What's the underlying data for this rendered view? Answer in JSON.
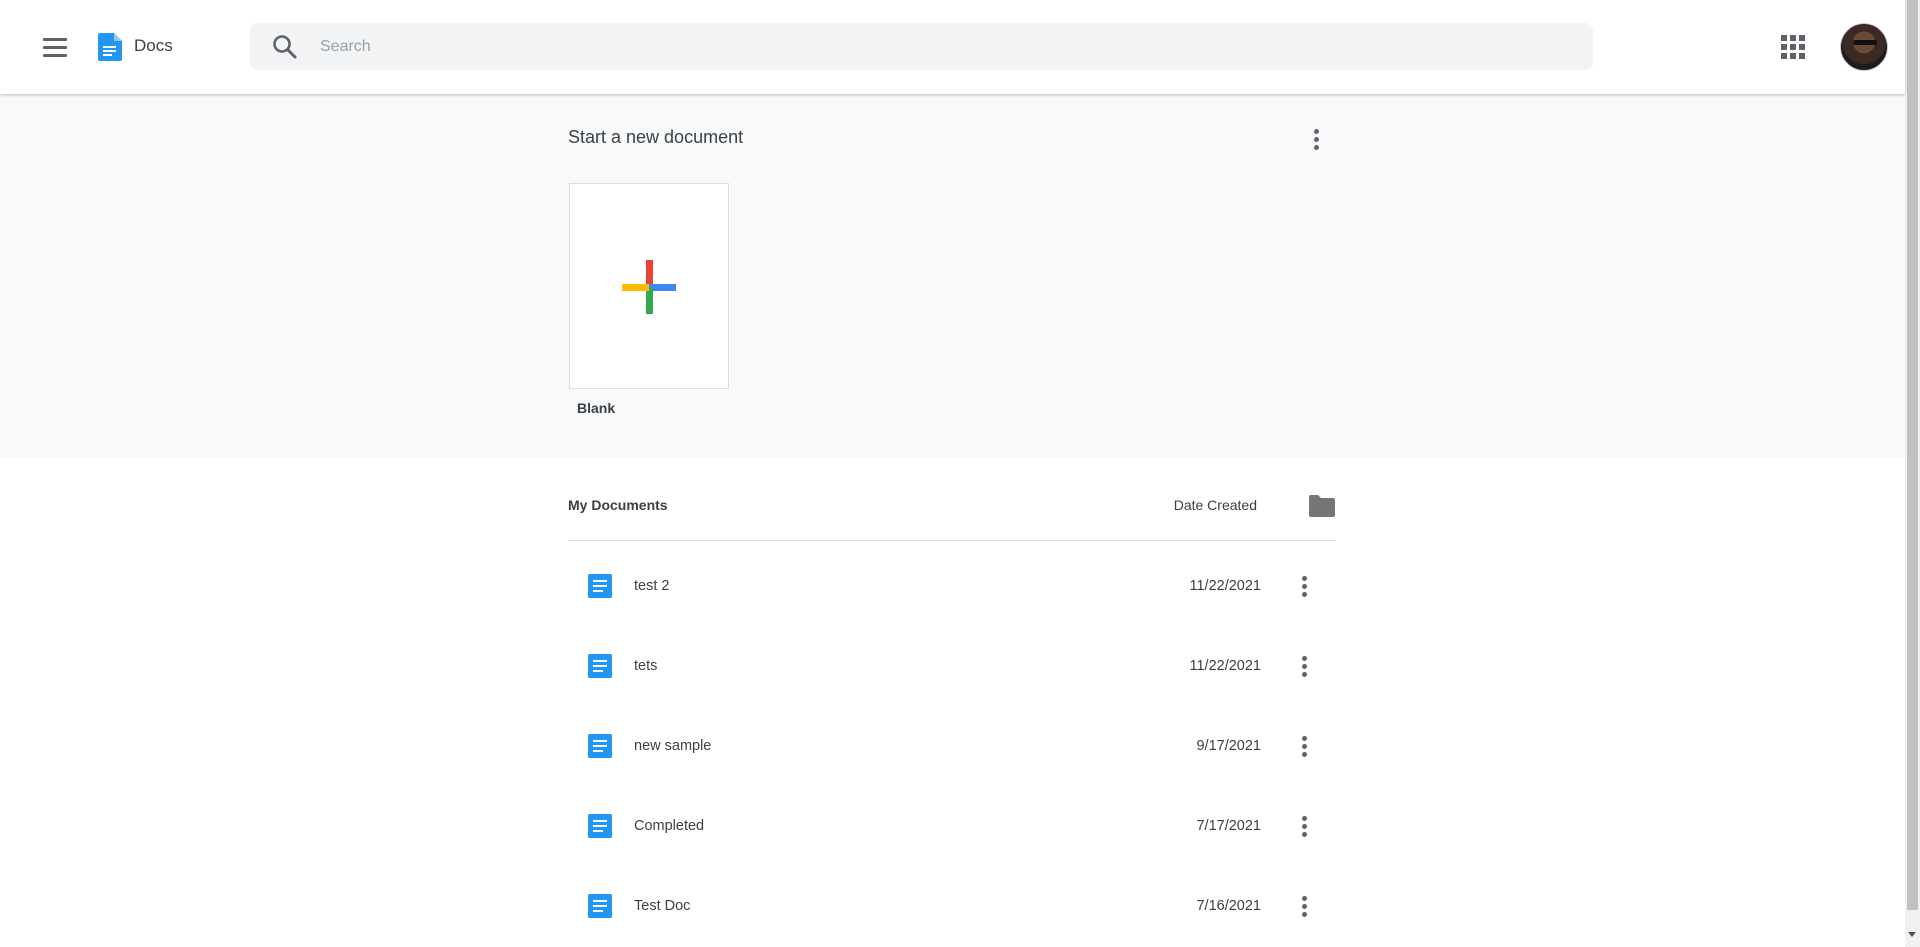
{
  "header": {
    "app_name": "Docs",
    "search_placeholder": "Search",
    "icons": [
      "hamburger-menu-icon",
      "docs-logo-icon",
      "search-icon",
      "apps-grid-icon",
      "avatar"
    ]
  },
  "templates": {
    "title": "Start a new document",
    "blank_label": "Blank"
  },
  "documents": {
    "title": "My Documents",
    "sort_label": "Date Created",
    "items": [
      {
        "title": "test 2",
        "date": "11/22/2021"
      },
      {
        "title": "tets",
        "date": "11/22/2021"
      },
      {
        "title": "new sample",
        "date": "9/17/2021"
      },
      {
        "title": "Completed",
        "date": "7/17/2021"
      },
      {
        "title": "Test Doc",
        "date": "7/16/2021"
      }
    ]
  },
  "colors": {
    "docs_blue": "#2196f3",
    "plus_red": "#ea4335",
    "plus_blue": "#4285f4",
    "plus_green": "#34a853",
    "plus_yellow": "#fbbc04"
  }
}
